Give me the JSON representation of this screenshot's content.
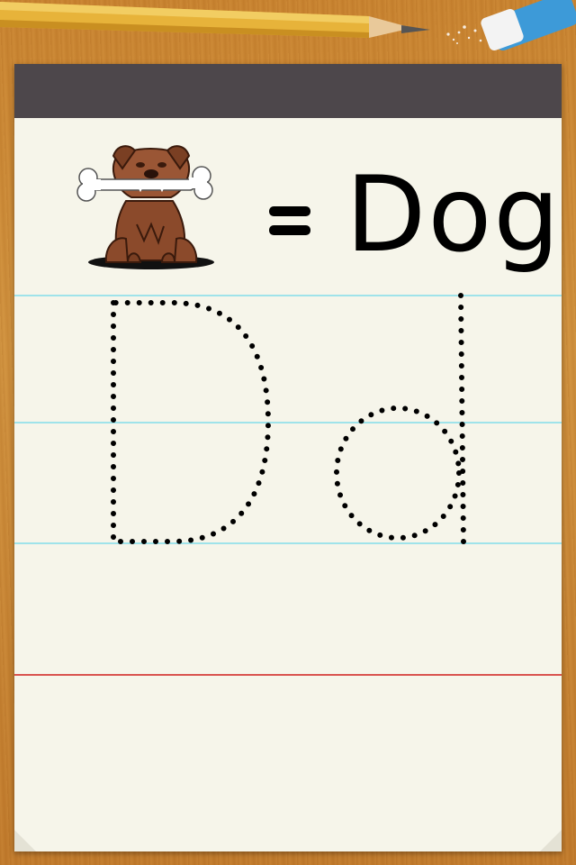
{
  "word": {
    "text": "Dog",
    "prefix": "="
  },
  "tracing": {
    "letters": [
      "D",
      "d"
    ]
  },
  "picture": {
    "subject": "dog-with-bone-icon"
  },
  "colors": {
    "paper": "#f6f5ea",
    "header": "#4d474b",
    "guide_line": "#9fe3ea",
    "margin_line": "#d9534f",
    "desk": "#c9832f",
    "dog_fur": "#8b4a2b"
  }
}
